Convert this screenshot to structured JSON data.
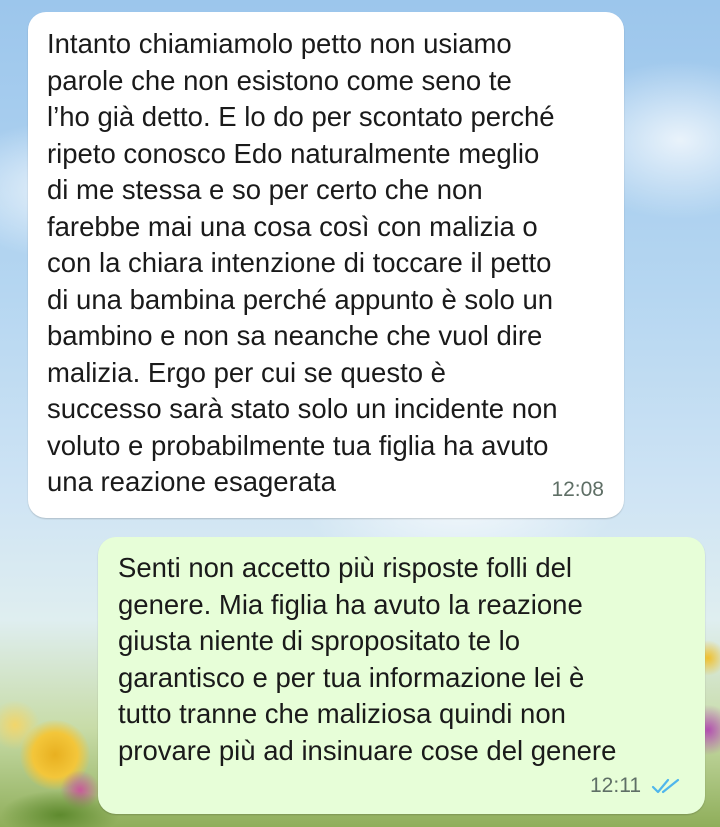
{
  "conversation": {
    "messages": [
      {
        "direction": "incoming",
        "text": "Intanto chiamiamolo petto non usiamo\nparole che non esistono come seno te\nl’ho già detto. E lo do per scontato perché\nripeto conosco Edo naturalmente meglio\ndi me stessa e so per certo che non\nfarebbe mai una cosa così con malizia o\ncon la chiara intenzione di toccare il petto\ndi una bambina perché appunto è solo un\nbambino e non sa neanche che vuol dire\nmalizia. Ergo per cui se questo è\nsuccesso sarà stato solo un incidente non\nvoluto e probabilmente tua figlia ha avuto\nuna reazione esagerata",
        "time": "12:08"
      },
      {
        "direction": "outgoing",
        "text": "Senti non accetto più risposte folli del\ngenere. Mia figlia ha avuto la reazione\ngiusta niente di spropositato te lo\ngarantisco e per tua informazione lei è\ntutto tranne che maliziosa quindi non\nprovare più ad insinuare cose del genere",
        "time": "12:11",
        "status_icon": "double-check-read-icon"
      }
    ]
  },
  "colors": {
    "incoming_bubble": "#ffffff",
    "outgoing_bubble": "#e7fed8",
    "read_ticks": "#4fb6ec",
    "timestamp": "#5f6f66"
  }
}
